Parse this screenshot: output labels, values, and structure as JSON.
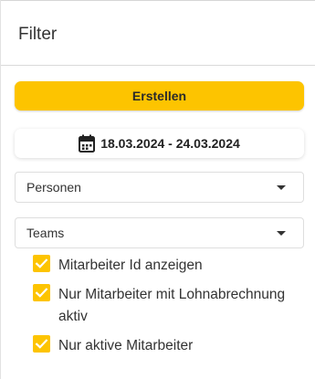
{
  "header": {
    "title": "Filter"
  },
  "actions": {
    "create_label": "Erstellen",
    "date_range": "18.03.2024 - 24.03.2024"
  },
  "filters": {
    "persons": {
      "selected": "Personen"
    },
    "teams": {
      "selected": "Teams"
    }
  },
  "options": [
    {
      "label": "Mitarbeiter Id anzeigen",
      "checked": true
    },
    {
      "label": "Nur Mitarbeiter mit Lohnabrechnung aktiv",
      "checked": true
    },
    {
      "label": "Nur aktive Mitarbeiter",
      "checked": true
    }
  ],
  "icons": {
    "date": "calendar-icon",
    "dropdown": "caret-down-icon",
    "check": "checkmark-icon"
  },
  "colors": {
    "accent": "#fdc400",
    "text": "#333333",
    "border": "#dedede"
  }
}
